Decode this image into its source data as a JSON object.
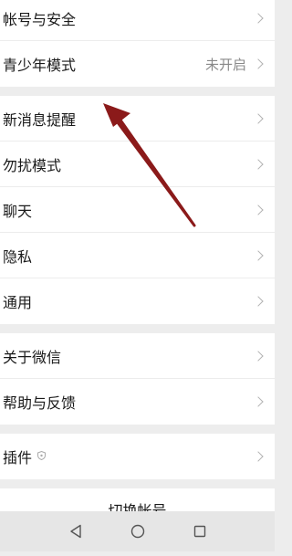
{
  "groups": [
    {
      "items": [
        {
          "label": "帐号与安全",
          "value": ""
        },
        {
          "label": "青少年模式",
          "value": "未开启"
        }
      ]
    },
    {
      "items": [
        {
          "label": "新消息提醒",
          "value": ""
        },
        {
          "label": "勿扰模式",
          "value": ""
        },
        {
          "label": "聊天",
          "value": ""
        },
        {
          "label": "隐私",
          "value": ""
        },
        {
          "label": "通用",
          "value": ""
        }
      ]
    },
    {
      "items": [
        {
          "label": "关于微信",
          "value": ""
        },
        {
          "label": "帮助与反馈",
          "value": ""
        }
      ]
    },
    {
      "items": [
        {
          "label": "插件",
          "value": ""
        }
      ]
    }
  ],
  "switch_account_label": "切换帐号",
  "annotation_arrow": {
    "color": "#8b1a1a",
    "points_to": "新消息提醒"
  },
  "navbar": {
    "icons": [
      "back-triangle-icon",
      "home-circle-icon",
      "recents-square-icon"
    ]
  }
}
